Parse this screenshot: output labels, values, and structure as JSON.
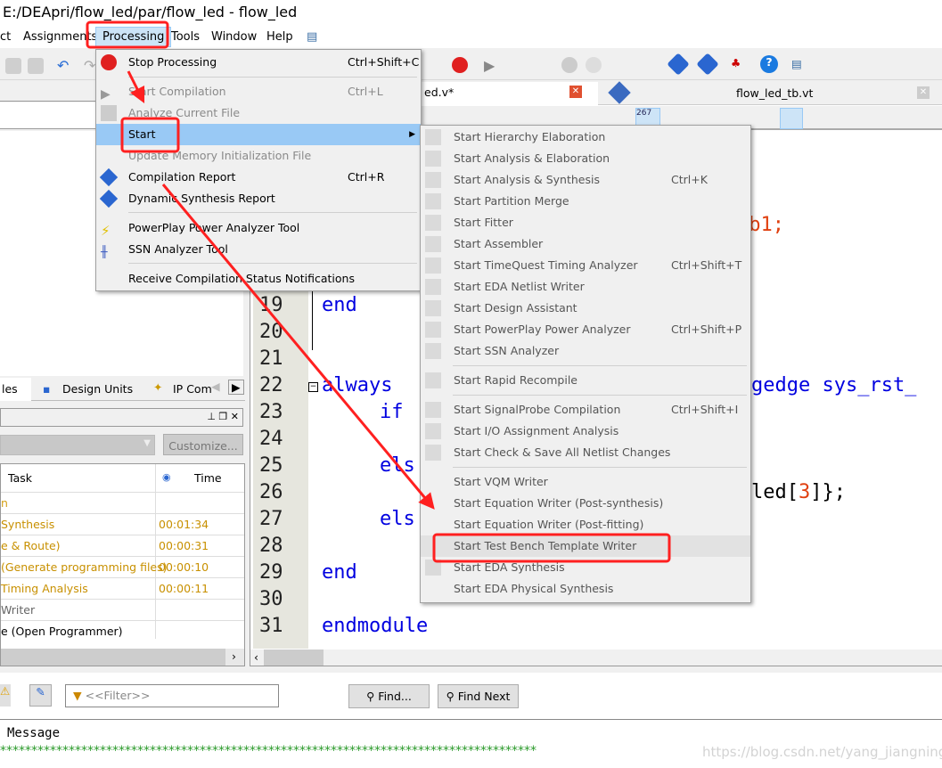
{
  "window": {
    "title": "E:/DEApri/flow_led/par/flow_led - flow_led"
  },
  "menubar": {
    "items": [
      "ct",
      "Assignments",
      "Processing",
      "Tools",
      "Window",
      "Help"
    ]
  },
  "processing_menu": [
    {
      "label": "Stop Processing",
      "shortcut": "Ctrl+Shift+C",
      "icon": "stop-icon",
      "enabled": true
    },
    {
      "label": "Start Compilation",
      "shortcut": "Ctrl+L",
      "icon": "play-icon",
      "enabled": false
    },
    {
      "label": "Analyze Current File",
      "shortcut": "",
      "icon": "analyze-icon",
      "enabled": false
    },
    {
      "label": "Start",
      "shortcut": "",
      "icon": "",
      "enabled": true,
      "highlighted": true
    },
    {
      "label": "Update Memory Initialization File",
      "shortcut": "",
      "enabled": false
    },
    {
      "label": "Compilation Report",
      "shortcut": "Ctrl+R",
      "icon": "report-icon",
      "enabled": true
    },
    {
      "label": "Dynamic Synthesis Report",
      "shortcut": "",
      "icon": "report-icon",
      "enabled": true
    },
    {
      "label": "PowerPlay Power Analyzer Tool",
      "shortcut": "",
      "icon": "lightning-icon",
      "enabled": true
    },
    {
      "label": "SSN Analyzer Tool",
      "shortcut": "",
      "icon": "ssn-icon",
      "enabled": true
    },
    {
      "label": "Receive Compilation Status Notifications",
      "shortcut": "",
      "enabled": true
    }
  ],
  "start_submenu": [
    {
      "label": "Start Hierarchy Elaboration",
      "shortcut": ""
    },
    {
      "label": "Start Analysis & Elaboration",
      "shortcut": ""
    },
    {
      "label": "Start Analysis & Synthesis",
      "shortcut": "Ctrl+K"
    },
    {
      "label": "Start Partition Merge",
      "shortcut": ""
    },
    {
      "label": "Start Fitter",
      "shortcut": ""
    },
    {
      "label": "Start Assembler",
      "shortcut": ""
    },
    {
      "label": "Start TimeQuest Timing Analyzer",
      "shortcut": "Ctrl+Shift+T"
    },
    {
      "label": "Start EDA Netlist Writer",
      "shortcut": ""
    },
    {
      "label": "Start Design Assistant",
      "shortcut": ""
    },
    {
      "label": "Start PowerPlay Power Analyzer",
      "shortcut": "Ctrl+Shift+P"
    },
    {
      "label": "Start SSN Analyzer",
      "shortcut": ""
    },
    {
      "label": "Start Rapid Recompile",
      "shortcut": ""
    },
    {
      "label": "Start SignalProbe Compilation",
      "shortcut": "Ctrl+Shift+I"
    },
    {
      "label": "Start I/O Assignment Analysis",
      "shortcut": ""
    },
    {
      "label": "Start Check & Save All Netlist Changes",
      "shortcut": ""
    },
    {
      "label": "Start VQM Writer",
      "shortcut": ""
    },
    {
      "label": "Start Equation Writer (Post-synthesis)",
      "shortcut": ""
    },
    {
      "label": "Start Equation Writer (Post-fitting)",
      "shortcut": ""
    },
    {
      "label": "Start Test Bench Template Writer",
      "shortcut": "",
      "highlighted": true
    },
    {
      "label": "Start EDA Synthesis",
      "shortcut": ""
    },
    {
      "label": "Start EDA Physical Synthesis",
      "shortcut": ""
    }
  ],
  "editor": {
    "tabs": [
      {
        "label": "ed.v*"
      },
      {
        "label": "flow_led_tb.vt"
      }
    ],
    "line_numbers": [
      "19",
      "20",
      "21",
      "22",
      "23",
      "24",
      "25",
      "26",
      "27",
      "28",
      "29",
      "30",
      "31"
    ],
    "fragments": {
      "b1": "'b1;",
      "end1": "end",
      "always": "always",
      "gedge": "gedge sys_rst_",
      "if": "if",
      "els1": "els",
      "led_pre": "led[",
      "led_num": "3",
      "led_post": "]};",
      "els2": "els",
      "end2": "end",
      "endmodule": "endmodule"
    },
    "toolbar_numbers": "267"
  },
  "left_panel": {
    "tabs": [
      "les",
      "Design Units",
      "IP Com"
    ],
    "customize": "Customize...",
    "table": {
      "headers": [
        "Task",
        "Time"
      ],
      "rows": [
        {
          "task": "n",
          "time": "",
          "color": "#d4a017"
        },
        {
          "task": "Synthesis",
          "time": "00:01:34",
          "color": "#c89000"
        },
        {
          "task": "e & Route)",
          "time": "00:00:31",
          "color": "#c89000"
        },
        {
          "task": " (Generate programming files)",
          "time": "00:00:10",
          "color": "#c89000"
        },
        {
          "task": " Timing Analysis",
          "time": "00:00:11",
          "color": "#c89000"
        },
        {
          "task": " Writer",
          "time": "",
          "color": "#666666"
        },
        {
          "task": "e (Open Programmer)",
          "time": "",
          "color": "#000000"
        }
      ]
    }
  },
  "messages": {
    "filter_placeholder": "<<Filter>>",
    "find": "Find...",
    "find_next": "Find Next",
    "column": "Message",
    "stars": "**************************************************************************************"
  },
  "watermark": "https://blog.csdn.net/yang_jiangning",
  "colors": {
    "menu_highlight": "#99c9f5",
    "annotation": "#ff2020",
    "keyword": "#0000e0"
  }
}
